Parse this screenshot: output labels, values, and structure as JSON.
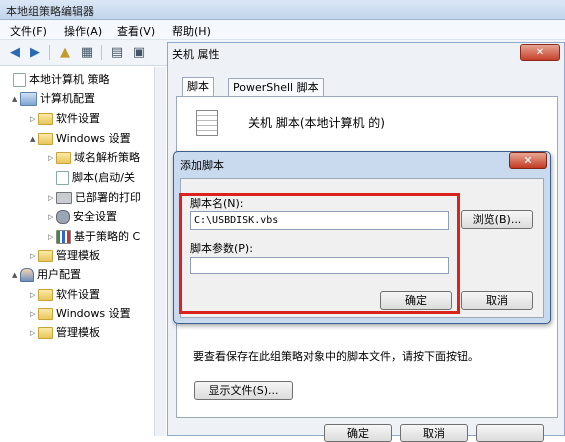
{
  "window": {
    "title": "本地组策略编辑器"
  },
  "menu": [
    "文件(F)",
    "操作(A)",
    "查看(V)",
    "帮助(H)"
  ],
  "tree": {
    "items": [
      {
        "label": "本地计算机 策略",
        "icon": "computer-policy-icon",
        "expander": "",
        "level": 0
      },
      {
        "label": "计算机配置",
        "icon": "computer-icon",
        "expander": "▲",
        "level": 1
      },
      {
        "label": "软件设置",
        "icon": "folder-icon",
        "expander": "▷",
        "level": 2
      },
      {
        "label": "Windows 设置",
        "icon": "folder-icon",
        "expander": "▲",
        "level": 2
      },
      {
        "label": "域名解析策略",
        "icon": "folder-icon",
        "expander": "▷",
        "level": 3
      },
      {
        "label": "脚本(启动/关",
        "icon": "script-icon",
        "expander": "",
        "level": 3
      },
      {
        "label": "已部署的打印",
        "icon": "printer-icon",
        "expander": "▷",
        "level": 3
      },
      {
        "label": "安全设置",
        "icon": "gear-icon",
        "expander": "▷",
        "level": 3
      },
      {
        "label": "基于策略的 C",
        "icon": "chart-icon",
        "expander": "▷",
        "level": 3
      },
      {
        "label": "管理模板",
        "icon": "folder-icon",
        "expander": "▷",
        "level": 2
      },
      {
        "label": "用户配置",
        "icon": "user-icon",
        "expander": "▲",
        "level": 1
      },
      {
        "label": "软件设置",
        "icon": "folder-icon",
        "expander": "▷",
        "level": 2
      },
      {
        "label": "Windows 设置",
        "icon": "folder-icon",
        "expander": "▷",
        "level": 2
      },
      {
        "label": "管理模板",
        "icon": "folder-icon",
        "expander": "▷",
        "level": 2
      }
    ]
  },
  "properties": {
    "title": "关机 属性",
    "tabs": [
      "脚本",
      "PowerShell 脚本"
    ],
    "heading": "关机 脚本(本地计算机 的)",
    "note": "要查看保存在此组策略对象中的脚本文件，请按下面按钮。",
    "show_files_button": "显示文件(S)...",
    "ok_button": "确定",
    "cancel_button": "取消"
  },
  "dialog": {
    "title": "添加脚本",
    "close_glyph": "✕",
    "script_name_label": "脚本名(N):",
    "script_name_value": "C:\\USBDISK.vbs",
    "browse_button": "浏览(B)...",
    "params_label": "脚本参数(P):",
    "params_value": "",
    "ok_button": "确定",
    "cancel_button": "取消"
  },
  "colors": {
    "highlight": "#d9231f",
    "accent": "#3d5f8c"
  }
}
